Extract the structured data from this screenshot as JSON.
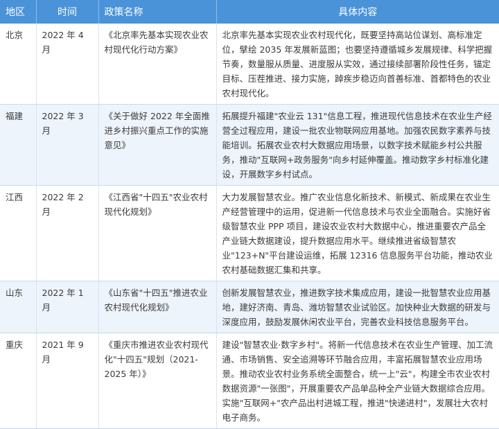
{
  "table": {
    "headers": [
      "地区",
      "时间",
      "政策名称",
      "具体内容"
    ],
    "rows": [
      {
        "region": "北京",
        "time": "2022 年 4 月",
        "policy": "《北京率先基本实现农业农村现代化行动方案》",
        "content": "北京率先基本实现农业农村现代化，既要坚持高站位谋划、高标准定位，擘绘 2035 年发展新蓝图；也要坚持遵循城乡发展规律、科学把握节奏，数量服从质量、进度服从实效，通过接续部署阶段性任务，锚定目标、压茬推进、接力实施，踔疾步稳迈向首善标准、首都特色的农业农村现代化。"
      },
      {
        "region": "福建",
        "time": "2022 年 3 月",
        "policy": "《关于做好 2022 年全面推进乡村振兴重点工作的实施意见》",
        "content": "拓展提升福建\"农业云 131\"信息工程，推进现代信息技术在农业生产经营全过程应用，建设一批农业物联网应用基地。加强农民数字素养与技能培训。拓展农业农村大数据应用场景，以数字技术赋能乡村公共服务，推动\"互联网+政务服务\"向乡村延伸覆盖。推动数字乡村标准化建设，开展数字乡村试点。"
      },
      {
        "region": "江西",
        "time": "2022 年 2 月",
        "policy": "《江西省\"十四五\"农业农村现代化规划》",
        "content": "大力发展智慧农业。推广农业信息化新技术、新模式、新成果在农业生产经营管理中的运用，促进新一代信息技术与农业全面融合。实施好省级智慧农业 PPP 项目，建设农业农村大数据中心，推进重要农产品全产业链大数据建设，提升数据应用水平。继续推进省级智慧农业\"123+N\"平台建设运维，拓展 12316 信息服务平台功能，推动农业农村基础数据汇集和共享。"
      },
      {
        "region": "山东",
        "time": "2022 年 1 月",
        "policy": "《山东省\"十四五\"推进农业农村现代化规划》",
        "content": "创新发展智慧农业，推进数字技术集成应用，建设一批智慧农业应用基地，建好济南、青岛、潍坊智慧农业试验区。加快种业大数据的研发与深度应用，鼓励发展休闲农业平台，完善农业科技信息服务平台。"
      },
      {
        "region": "重庆",
        "time": "2021 年 9 月",
        "policy": "《重庆市推进农业农村现代化\"十四五\"规划（2021-2025 年）》",
        "content": "建设\"智慧农业·数字乡村\"。将新一代信息技术在农业生产管理、加工流通、市场销售、安全追溯等环节融合应用，丰富拓展智慧农业应用场景。推动农业农村业务系统全面整合，统一上\"云\"，构建全市农业农村数据资源\"一张图\"，开展重要农产品单品种全产业链大数据综合应用。实施\"互联网+\"农产品出村进城工程，推进\"快递进村\"，发展壮大农村电子商务。"
      }
    ]
  }
}
